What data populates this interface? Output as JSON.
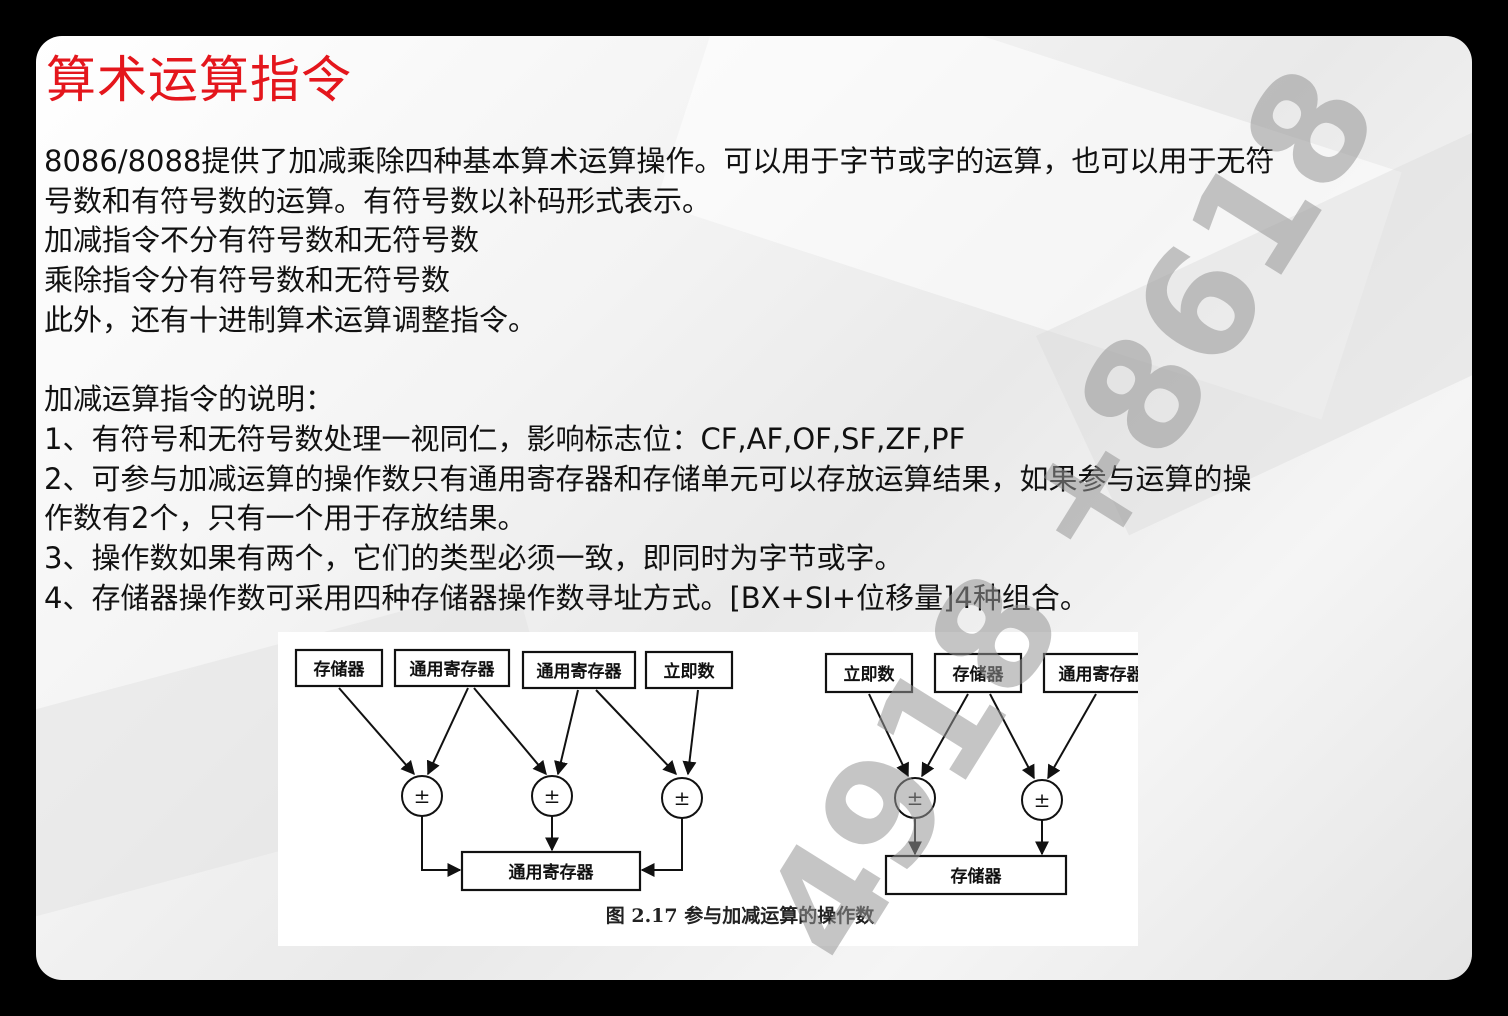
{
  "slide": {
    "title": "算术运算指令",
    "lines": [
      "8086/8088提供了加减乘除四种基本算术运算操作。可以用于字节或字的运算，也可以用于无符",
      "号数和有符号数的运算。有符号数以补码形式表示。",
      "加减指令不分有符号数和无符号数",
      "乘除指令分有符号数和无符号数",
      "此外，还有十进制算术运算调整指令。",
      "",
      "加减运算指令的说明：",
      "1、有符号和无符号数处理一视同仁，影响标志位：CF,AF,OF,SF,ZF,PF",
      "2、可参与加减运算的操作数只有通用寄存器和存储单元可以存放运算结果，如果参与运算的操",
      "作数有2个，只有一个用于存放结果。",
      "3、操作数如果有两个，它们的类型必须一致，即同时为字节或字。",
      "4、存储器操作数可采用四种存储器操作数寻址方式。[BX+SI+位移量]4种组合。"
    ]
  },
  "figure": {
    "left_diagram": {
      "sources": [
        "存储器",
        "通用寄存器",
        "通用寄存器",
        "立即数"
      ],
      "operators": [
        "±",
        "±",
        "±"
      ],
      "destination": "通用寄存器"
    },
    "right_diagram": {
      "sources": [
        "立即数",
        "存储器",
        "通用寄存器"
      ],
      "operators": [
        "±",
        "±"
      ],
      "destination": "存储器"
    },
    "caption": "图 2.17   参与加减运算的操作数"
  },
  "watermark": "4918 +8618"
}
